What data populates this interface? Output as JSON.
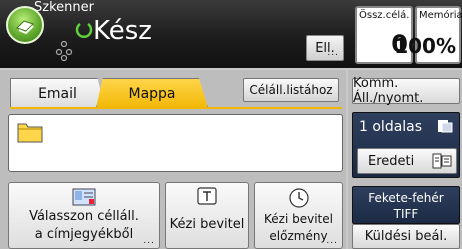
{
  "header": {
    "app_name": "Szkenner",
    "status": "Kész",
    "check_label": "Ell.",
    "total_dest": {
      "label": "Össz.célá.",
      "value": "0"
    },
    "memory": {
      "label": "Memória",
      "value": "100%"
    }
  },
  "tabs": [
    {
      "label": "Email",
      "active": false
    },
    {
      "label": "Mappa",
      "active": true
    }
  ],
  "dest_list_button": "Céláll.listához",
  "actions": {
    "select_from_addressbook": [
      "Válasszon célláll.",
      "a címjegyékből"
    ],
    "manual_entry": "Kézi bevitel",
    "manual_history": [
      "Kézi bevitel",
      "előzmény"
    ]
  },
  "right": {
    "comm_status": "Komm. Áll./nyomt.",
    "pages": "1 oldalas",
    "original": "Eredeti",
    "color_mode": [
      "Fekete-fehér",
      "TIFF"
    ],
    "send_settings": "Küldési beál."
  },
  "colors": {
    "folder_tab": "#f2b705",
    "header": "#1d1d1d",
    "accent_green": "#5da52a",
    "dark_panel": "#24344f"
  }
}
